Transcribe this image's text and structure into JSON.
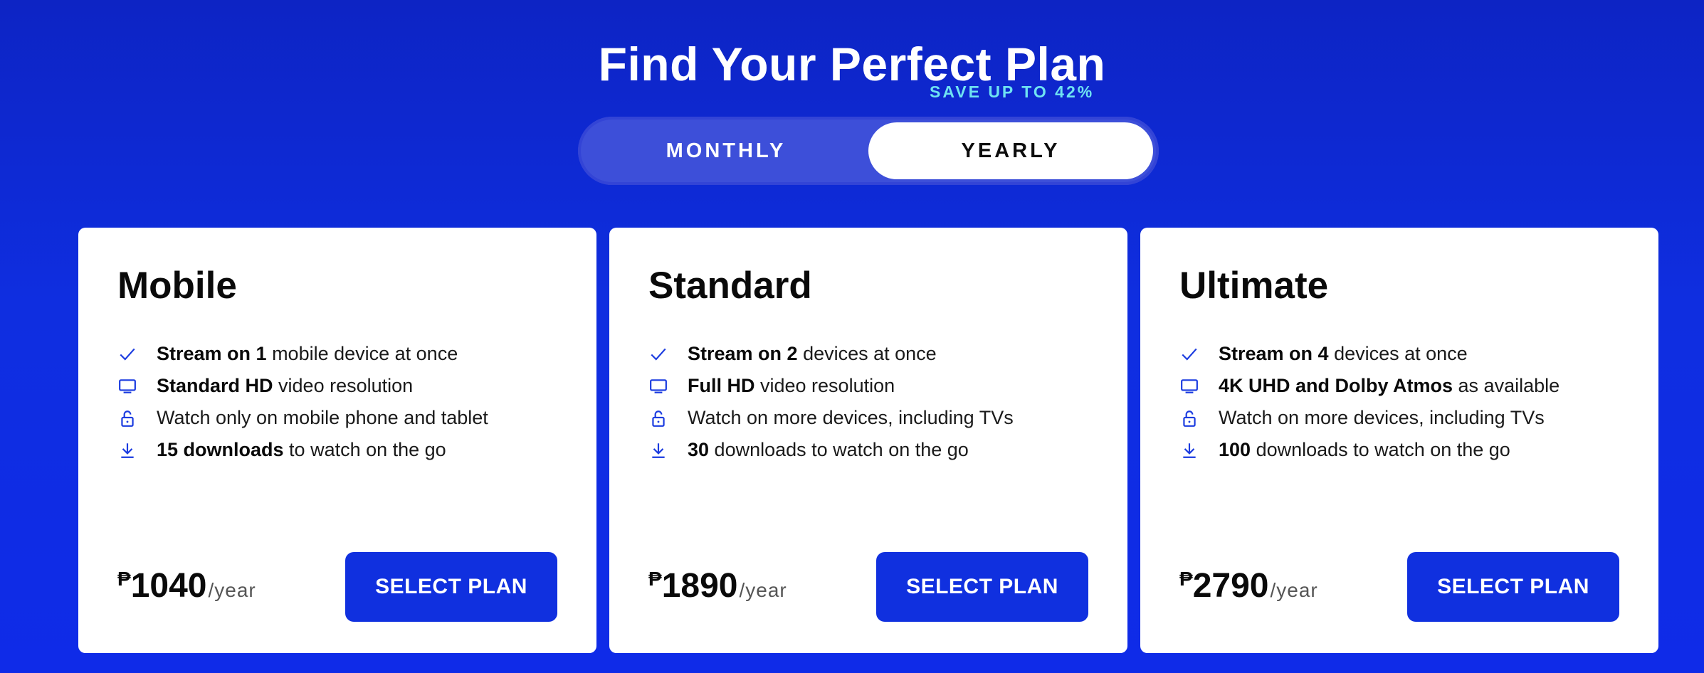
{
  "header": {
    "title": "Find Your Perfect Plan",
    "save_badge": "SAVE UP TO 42%"
  },
  "billing_toggle": {
    "monthly_label": "MONTHLY",
    "yearly_label": "YEARLY",
    "selected": "YEARLY"
  },
  "colors": {
    "background": "#0f2be8",
    "accent_button": "#1030df",
    "save_badge": "#6fe3f2",
    "icon": "#1a3be0"
  },
  "plans": [
    {
      "name": "Mobile",
      "features": [
        {
          "icon": "check-icon",
          "bold": "Stream on 1",
          "text": " mobile device at once"
        },
        {
          "icon": "monitor-icon",
          "bold": "Standard HD",
          "text": " video resolution"
        },
        {
          "icon": "unlock-icon",
          "bold": "",
          "text": "Watch only on mobile phone and tablet"
        },
        {
          "icon": "download-icon",
          "bold": "15 downloads",
          "text": " to watch on the go"
        }
      ],
      "currency": "₱",
      "price": "1040",
      "period": "/year",
      "cta": "SELECT PLAN"
    },
    {
      "name": "Standard",
      "features": [
        {
          "icon": "check-icon",
          "bold": "Stream on 2",
          "text": " devices at once"
        },
        {
          "icon": "monitor-icon",
          "bold": "Full HD",
          "text": " video resolution"
        },
        {
          "icon": "unlock-icon",
          "bold": "",
          "text": "Watch on more devices, including TVs"
        },
        {
          "icon": "download-icon",
          "bold": "30",
          "text": " downloads to watch on the go"
        }
      ],
      "currency": "₱",
      "price": "1890",
      "period": "/year",
      "cta": "SELECT PLAN"
    },
    {
      "name": "Ultimate",
      "features": [
        {
          "icon": "check-icon",
          "bold": "Stream on 4",
          "text": " devices at once"
        },
        {
          "icon": "monitor-icon",
          "bold": "4K UHD and Dolby Atmos",
          "text": " as available"
        },
        {
          "icon": "unlock-icon",
          "bold": "",
          "text": "Watch on more devices, including TVs"
        },
        {
          "icon": "download-icon",
          "bold": "100",
          "text": " downloads to watch on the go"
        }
      ],
      "currency": "₱",
      "price": "2790",
      "period": "/year",
      "cta": "SELECT PLAN"
    }
  ]
}
